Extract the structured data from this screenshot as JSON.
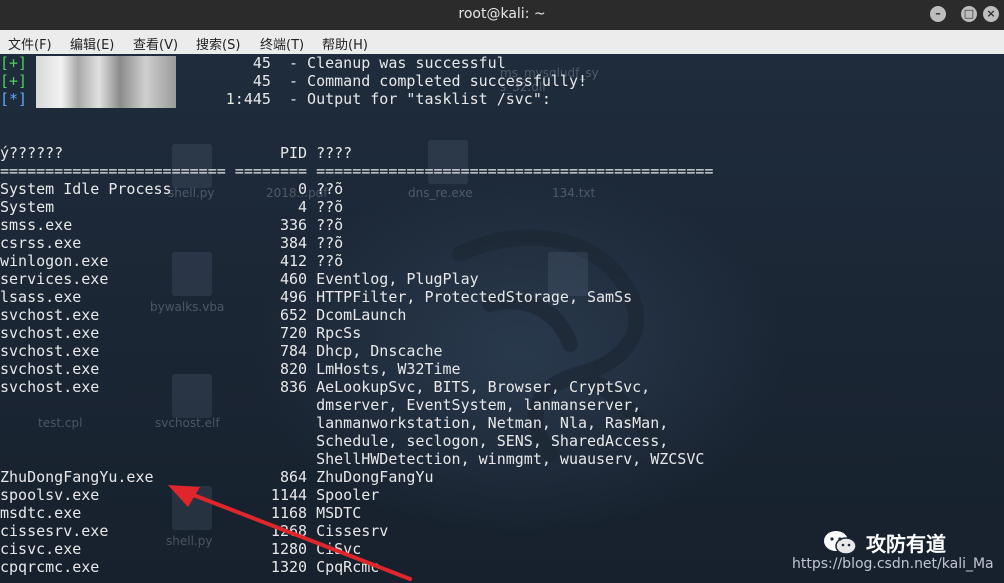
{
  "window": {
    "title": "root@kali: ~",
    "controls": [
      {
        "name": "minimize-button",
        "glyph": "–"
      },
      {
        "name": "maximize-button",
        "glyph": "□"
      },
      {
        "name": "close-button",
        "glyph": "×"
      }
    ]
  },
  "menu": [
    "文件(F)",
    "编辑(E)",
    "查看(V)",
    "搜索(S)",
    "终端(T)",
    "帮助(H)"
  ],
  "terminal": {
    "status_lines": [
      {
        "prefix": "[+]",
        "kind": "ok",
        "addr": "45",
        "message": "  - Cleanup was successful"
      },
      {
        "prefix": "[+]",
        "kind": "ok",
        "addr": "45",
        "message": "  - Command completed successfully!"
      },
      {
        "prefix": "[*]",
        "kind": "info",
        "addr": "1:445",
        "message": "  - Output for \"tasklist /svc\":"
      }
    ],
    "header": {
      "image_name": "ý??????",
      "pid": "PID",
      "services": "????"
    },
    "separator": "========================= ======== ============================================",
    "rows": [
      {
        "name": "System Idle Process",
        "pid": "0",
        "svc": [
          "??õ"
        ]
      },
      {
        "name": "System",
        "pid": "4",
        "svc": [
          "??õ"
        ]
      },
      {
        "name": "smss.exe",
        "pid": "336",
        "svc": [
          "??õ"
        ]
      },
      {
        "name": "csrss.exe",
        "pid": "384",
        "svc": [
          "??õ"
        ]
      },
      {
        "name": "winlogon.exe",
        "pid": "412",
        "svc": [
          "??õ"
        ]
      },
      {
        "name": "services.exe",
        "pid": "460",
        "svc": [
          "Eventlog, PlugPlay"
        ]
      },
      {
        "name": "lsass.exe",
        "pid": "496",
        "svc": [
          "HTTPFilter, ProtectedStorage, SamSs"
        ]
      },
      {
        "name": "svchost.exe",
        "pid": "652",
        "svc": [
          "DcomLaunch"
        ]
      },
      {
        "name": "svchost.exe",
        "pid": "720",
        "svc": [
          "RpcSs"
        ]
      },
      {
        "name": "svchost.exe",
        "pid": "784",
        "svc": [
          "Dhcp, Dnscache"
        ]
      },
      {
        "name": "svchost.exe",
        "pid": "820",
        "svc": [
          "LmHosts, W32Time"
        ]
      },
      {
        "name": "svchost.exe",
        "pid": "836",
        "svc": [
          "AeLookupSvc, BITS, Browser, CryptSvc,",
          "dmserver, EventSystem, lanmanserver,",
          "lanmanworkstation, Netman, Nla, RasMan,",
          "Schedule, seclogon, SENS, SharedAccess,",
          "ShellHWDetection, winmgmt, wuauserv, WZCSVC"
        ]
      },
      {
        "name": "ZhuDongFangYu.exe",
        "pid": "864",
        "svc": [
          "ZhuDongFangYu"
        ]
      },
      {
        "name": "spoolsv.exe",
        "pid": "1144",
        "svc": [
          "Spooler"
        ]
      },
      {
        "name": "msdtc.exe",
        "pid": "1168",
        "svc": [
          "MSDTC"
        ]
      },
      {
        "name": "cissesrv.exe",
        "pid": "1268",
        "svc": [
          "Cissesrv"
        ]
      },
      {
        "name": "cisvc.exe",
        "pid": "1280",
        "svc": [
          "CiSvc"
        ]
      },
      {
        "name": "cpqrcmc.exe",
        "pid": "1320",
        "svc": [
          "CpqRcmc"
        ]
      }
    ]
  },
  "desktop_labels": [
    "shell.py",
    "bywalks.vba",
    "test.cpl",
    "svchost.elf",
    "shell.py",
    "dns_re.exe",
    "134.txt",
    "2018...pdf",
    "ms_mysqludf_sy s_32.dll"
  ],
  "watermark": {
    "logo_text": "攻防有道",
    "url": "https://blog.csdn.net/kali_Ma",
    "overlay": "@稀土掘金技术社区"
  },
  "colors": {
    "ok": "#4fd15a",
    "info": "#5ea8ff",
    "arrow": "#e0262b"
  }
}
